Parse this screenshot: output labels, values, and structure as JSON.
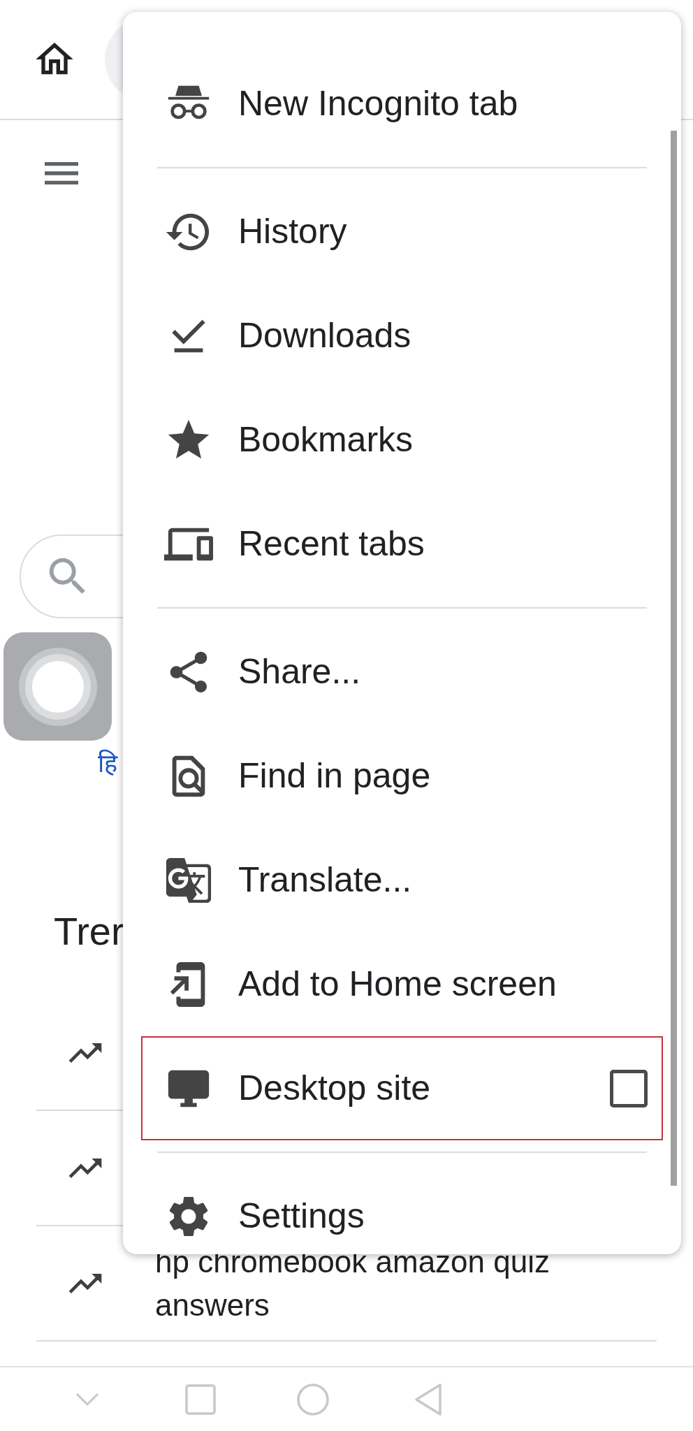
{
  "background": {
    "hindi_link": "हि",
    "heading": "Trer",
    "trending": [
      {
        "kind": "covered"
      },
      {
        "kind": "covered"
      },
      {
        "kind": "query",
        "text": "hp chromebook amazon quiz answers"
      }
    ]
  },
  "menu": {
    "sections": [
      [
        {
          "label": "New Incognito tab",
          "highlighted": false
        }
      ],
      [
        {
          "label": "History",
          "highlighted": false
        },
        {
          "label": "Downloads",
          "highlighted": false
        },
        {
          "label": "Bookmarks",
          "highlighted": false
        },
        {
          "label": "Recent tabs",
          "highlighted": false
        }
      ],
      [
        {
          "label": "Share...",
          "highlighted": false
        },
        {
          "label": "Find in page",
          "highlighted": false
        },
        {
          "label": "Translate...",
          "highlighted": false
        },
        {
          "label": "Add to Home screen",
          "highlighted": false
        },
        {
          "label": "Desktop site",
          "highlighted": true,
          "checkbox": {
            "checked": false
          }
        }
      ],
      [
        {
          "label": "Settings",
          "highlighted": false
        }
      ]
    ]
  }
}
